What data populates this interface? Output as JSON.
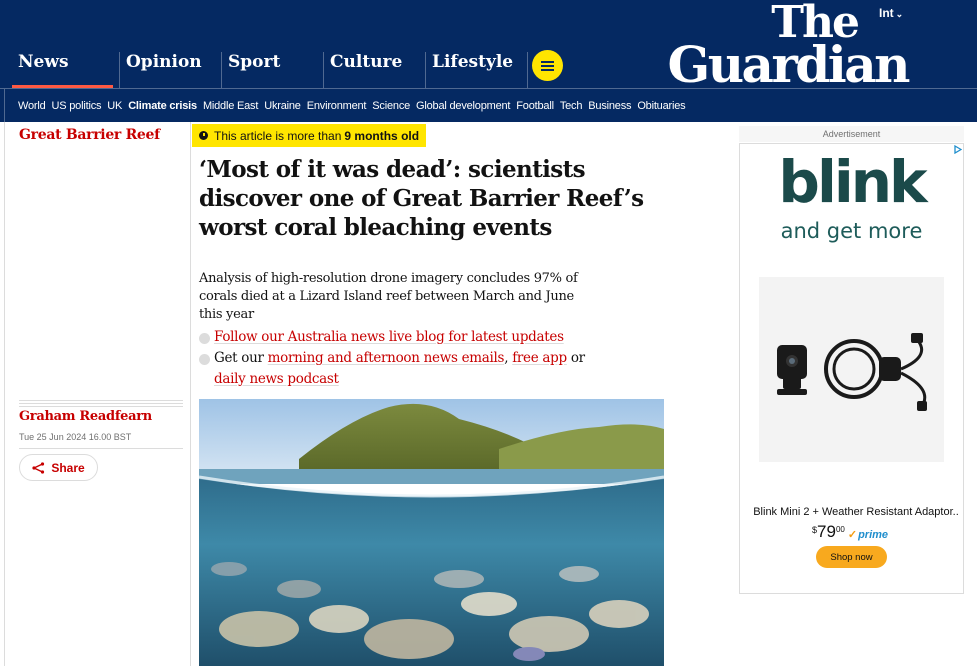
{
  "header": {
    "edition": "Int",
    "logo_line1": "The",
    "logo_line2": "Guardian",
    "pillars": [
      "News",
      "Opinion",
      "Sport",
      "Culture",
      "Lifestyle"
    ],
    "subnav": [
      "World",
      "US politics",
      "UK",
      "Climate crisis",
      "Middle East",
      "Ukraine",
      "Environment",
      "Science",
      "Global development",
      "Football",
      "Tech",
      "Business",
      "Obituaries"
    ],
    "subnav_active": "Climate crisis",
    "colors": {
      "brand": "#052962",
      "accent": "#ffe500",
      "news_underline": "#ff5943"
    }
  },
  "article": {
    "section_tag": "Great Barrier Reef",
    "age_prefix": "This article is more than",
    "age_value": "9 months old",
    "headline": "‘Most of it was dead’: scientists discover one of Great Barrier Reef’s worst coral bleaching events",
    "standfirst": "Analysis of high-resolution drone imagery concludes 97% of corals died at a Lizard Island reef between March and June this year",
    "bullet1_link": "Follow our Australia news live blog for latest updates",
    "bullet2_pre": "Get our",
    "bullet2_link1": "morning and afternoon news emails",
    "bullet2_comma": ",",
    "bullet2_link2": "free app",
    "bullet2_or": "or",
    "bullet2_link3": "daily news podcast",
    "author": "Graham Readfearn",
    "date": "Tue 25 Jun 2024 16.00 BST",
    "share_label": "Share",
    "accent_color": "#c70000"
  },
  "ad": {
    "label": "Advertisement",
    "brand": "blink",
    "tagline": "and get more",
    "product_name": "Blink Mini 2 + Weather Resistant Adaptor..",
    "price_currency": "$",
    "price_whole": "79",
    "price_fraction": "00",
    "prime": "prime",
    "cta": "Shop now"
  }
}
